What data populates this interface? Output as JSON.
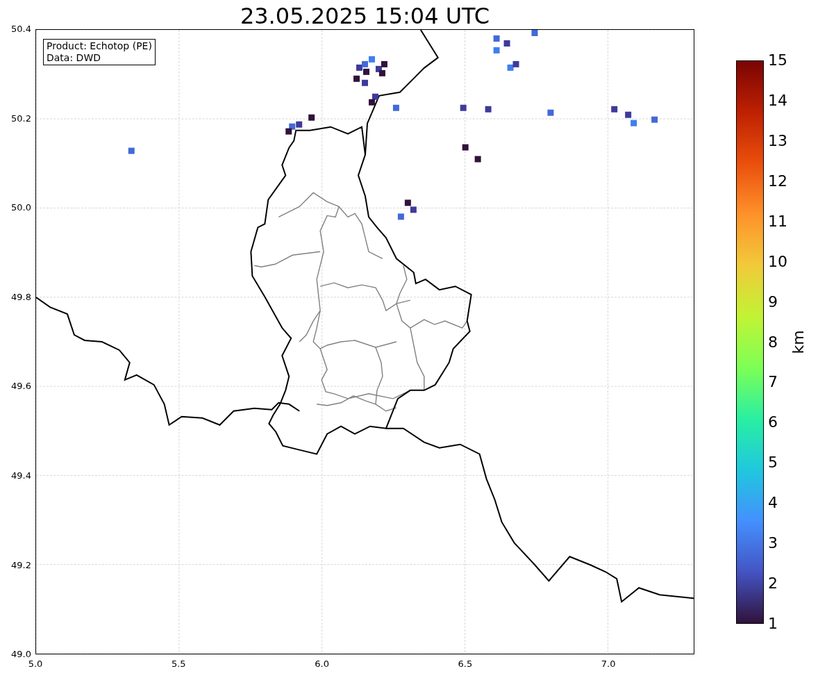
{
  "title": "23.05.2025 15:04 UTC",
  "legend": [
    "Product: Echotop (PE)",
    "Data: DWD"
  ],
  "x_ticks": [
    "5.0",
    "5.5",
    "6.0",
    "6.5",
    "7.0"
  ],
  "y_ticks": [
    "50.4",
    "50.2",
    "50.0",
    "49.8",
    "49.6",
    "49.4",
    "49.2",
    "49.0"
  ],
  "colorbar": {
    "ticks": [
      "15",
      "14",
      "13",
      "12",
      "11",
      "10",
      "9",
      "8",
      "7",
      "6",
      "5",
      "4",
      "3",
      "2",
      "1"
    ],
    "label": "km"
  }
}
